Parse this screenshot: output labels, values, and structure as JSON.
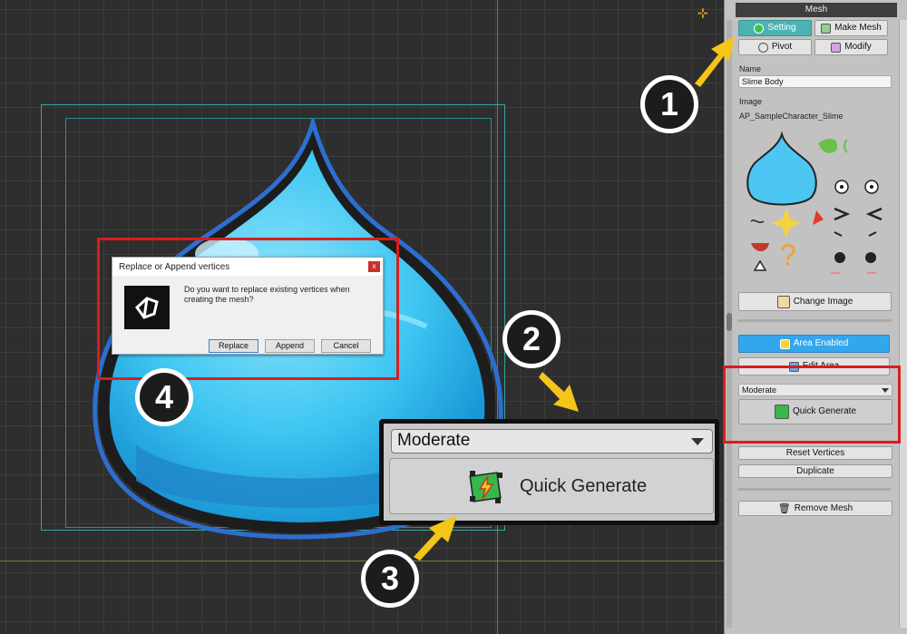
{
  "viewport": {
    "tool_icon": "pivot-tool-icon"
  },
  "dialog": {
    "title": "Replace or Append vertices",
    "close": "x",
    "message": "Do you want to replace existing vertices when creating the mesh?",
    "buttons": {
      "replace": "Replace",
      "append": "Append",
      "cancel": "Cancel"
    }
  },
  "zoom": {
    "select_value": "Moderate",
    "button_label": "Quick Generate"
  },
  "inspector": {
    "header": "Mesh",
    "tabs": {
      "setting": "Setting",
      "make_mesh": "Make Mesh",
      "pivot": "Pivot",
      "modify": "Modify"
    },
    "name_label": "Name",
    "name_value": "Slime Body",
    "image_label": "Image",
    "image_value": "AP_SampleCharacter_Slime",
    "change_image": "Change Image",
    "area_enabled": "Area Enabled",
    "edit_area": "Edit Area",
    "density_value": "Moderate",
    "quick_generate": "Quick Generate",
    "reset_vertices": "Reset Vertices",
    "duplicate": "Duplicate",
    "remove_mesh": "Remove Mesh"
  },
  "callouts": {
    "one": "1",
    "two": "2",
    "three": "3",
    "four": "4"
  },
  "colors": {
    "accent_teal": "#4bb3b2",
    "accent_blue": "#33a7ee",
    "highlight_red": "#d91d1d",
    "arrow_yellow": "#f5c518"
  }
}
